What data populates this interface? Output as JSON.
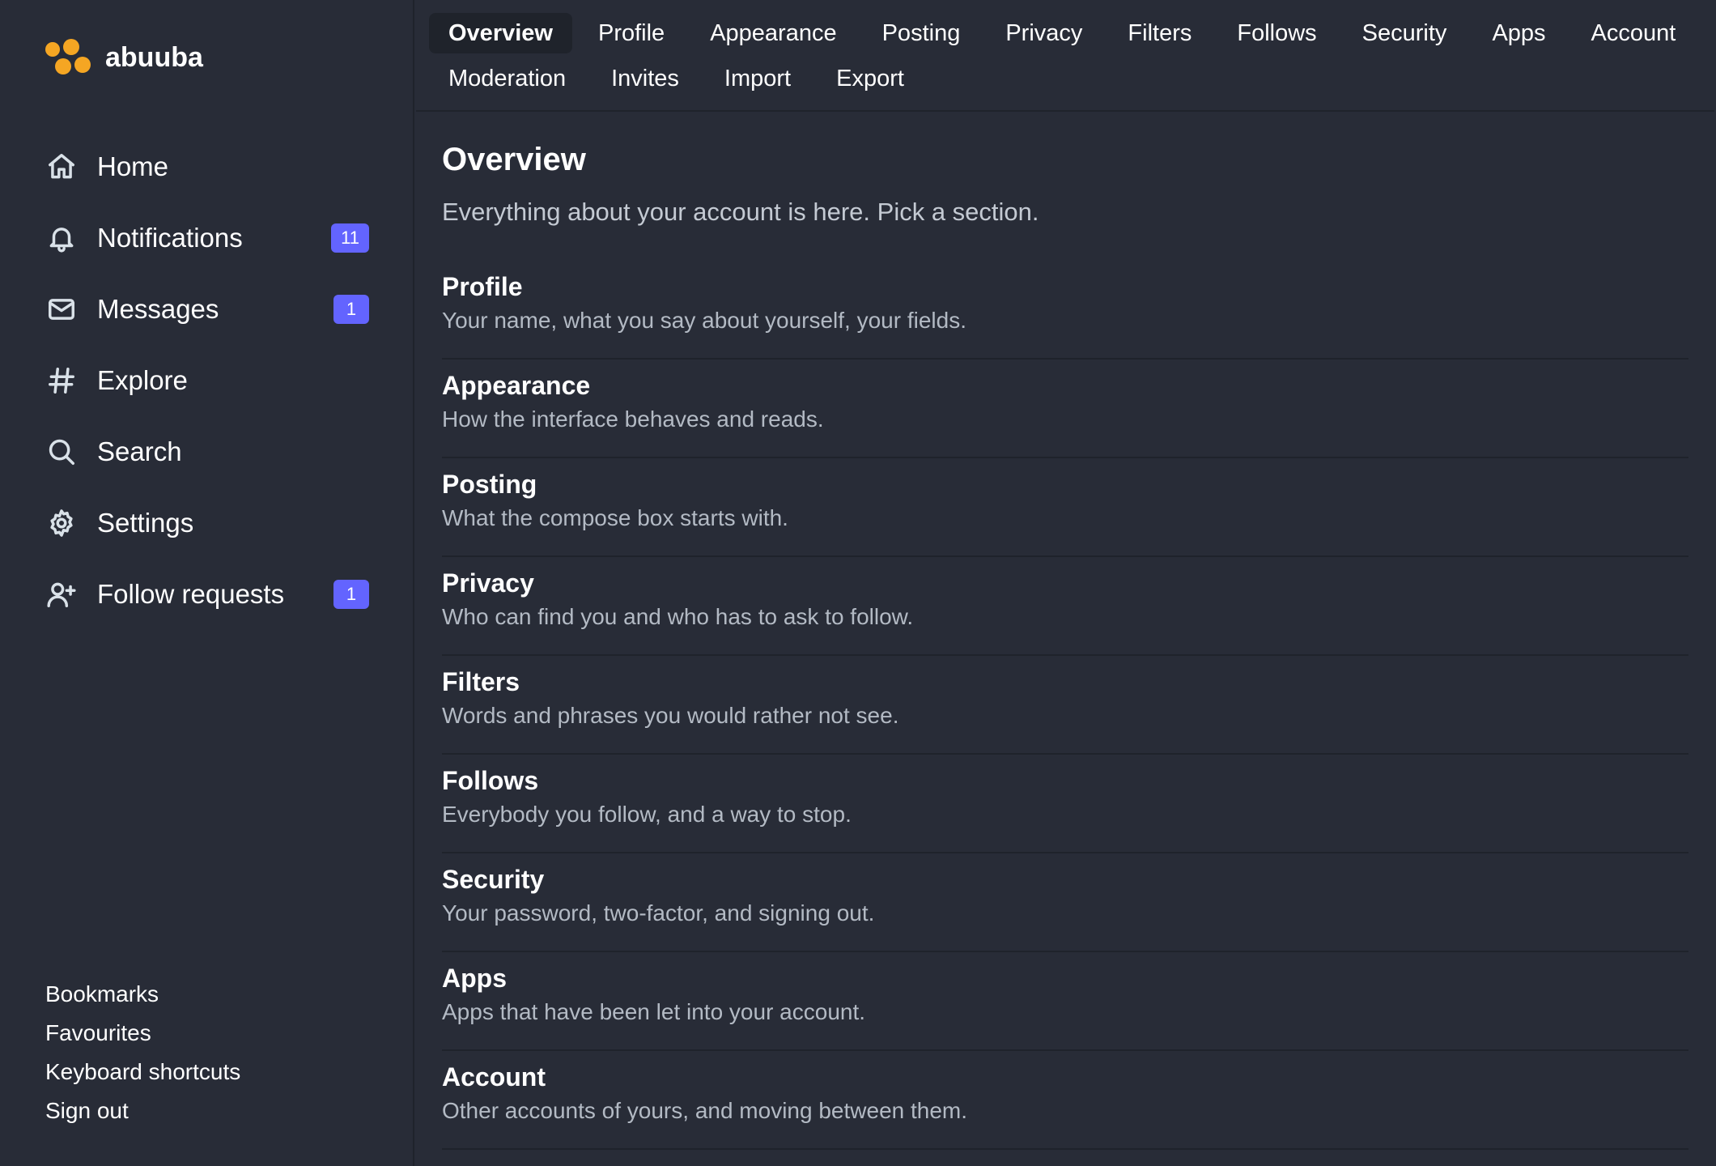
{
  "brand": {
    "name": "abuuba",
    "logo_icon": "dots-logo-icon",
    "logo_color": "#f5a623"
  },
  "sidebar": {
    "items": [
      {
        "label": "Home",
        "icon": "home-icon",
        "badge": ""
      },
      {
        "label": "Notifications",
        "icon": "bell-icon",
        "badge": "11"
      },
      {
        "label": "Messages",
        "icon": "envelope-icon",
        "badge": "1"
      },
      {
        "label": "Explore",
        "icon": "hash-icon",
        "badge": ""
      },
      {
        "label": "Search",
        "icon": "search-icon",
        "badge": ""
      },
      {
        "label": "Settings",
        "icon": "gear-icon",
        "badge": ""
      },
      {
        "label": "Follow requests",
        "icon": "user-plus-icon",
        "badge": "1"
      }
    ],
    "footer_links": [
      "Bookmarks",
      "Favourites",
      "Keyboard shortcuts",
      "Sign out"
    ],
    "badge_color": "#6364ff"
  },
  "tabs": {
    "row1": [
      "Overview",
      "Profile",
      "Appearance",
      "Posting",
      "Privacy",
      "Filters",
      "Follows",
      "Security",
      "Apps",
      "Account"
    ],
    "row2": [
      "Moderation",
      "Invites",
      "Import",
      "Export"
    ],
    "active": "Overview"
  },
  "main": {
    "title": "Overview",
    "subtitle": "Everything about your account is here. Pick a section.",
    "sections": [
      {
        "title": "Profile",
        "description": "Your name, what you say about yourself, your fields."
      },
      {
        "title": "Appearance",
        "description": "How the interface behaves and reads."
      },
      {
        "title": "Posting",
        "description": "What the compose box starts with."
      },
      {
        "title": "Privacy",
        "description": "Who can find you and who has to ask to follow."
      },
      {
        "title": "Filters",
        "description": "Words and phrases you would rather not see."
      },
      {
        "title": "Follows",
        "description": "Everybody you follow, and a way to stop."
      },
      {
        "title": "Security",
        "description": "Your password, two-factor, and signing out."
      },
      {
        "title": "Apps",
        "description": "Apps that have been let into your account."
      },
      {
        "title": "Account",
        "description": "Other accounts of yours, and moving between them."
      }
    ]
  }
}
